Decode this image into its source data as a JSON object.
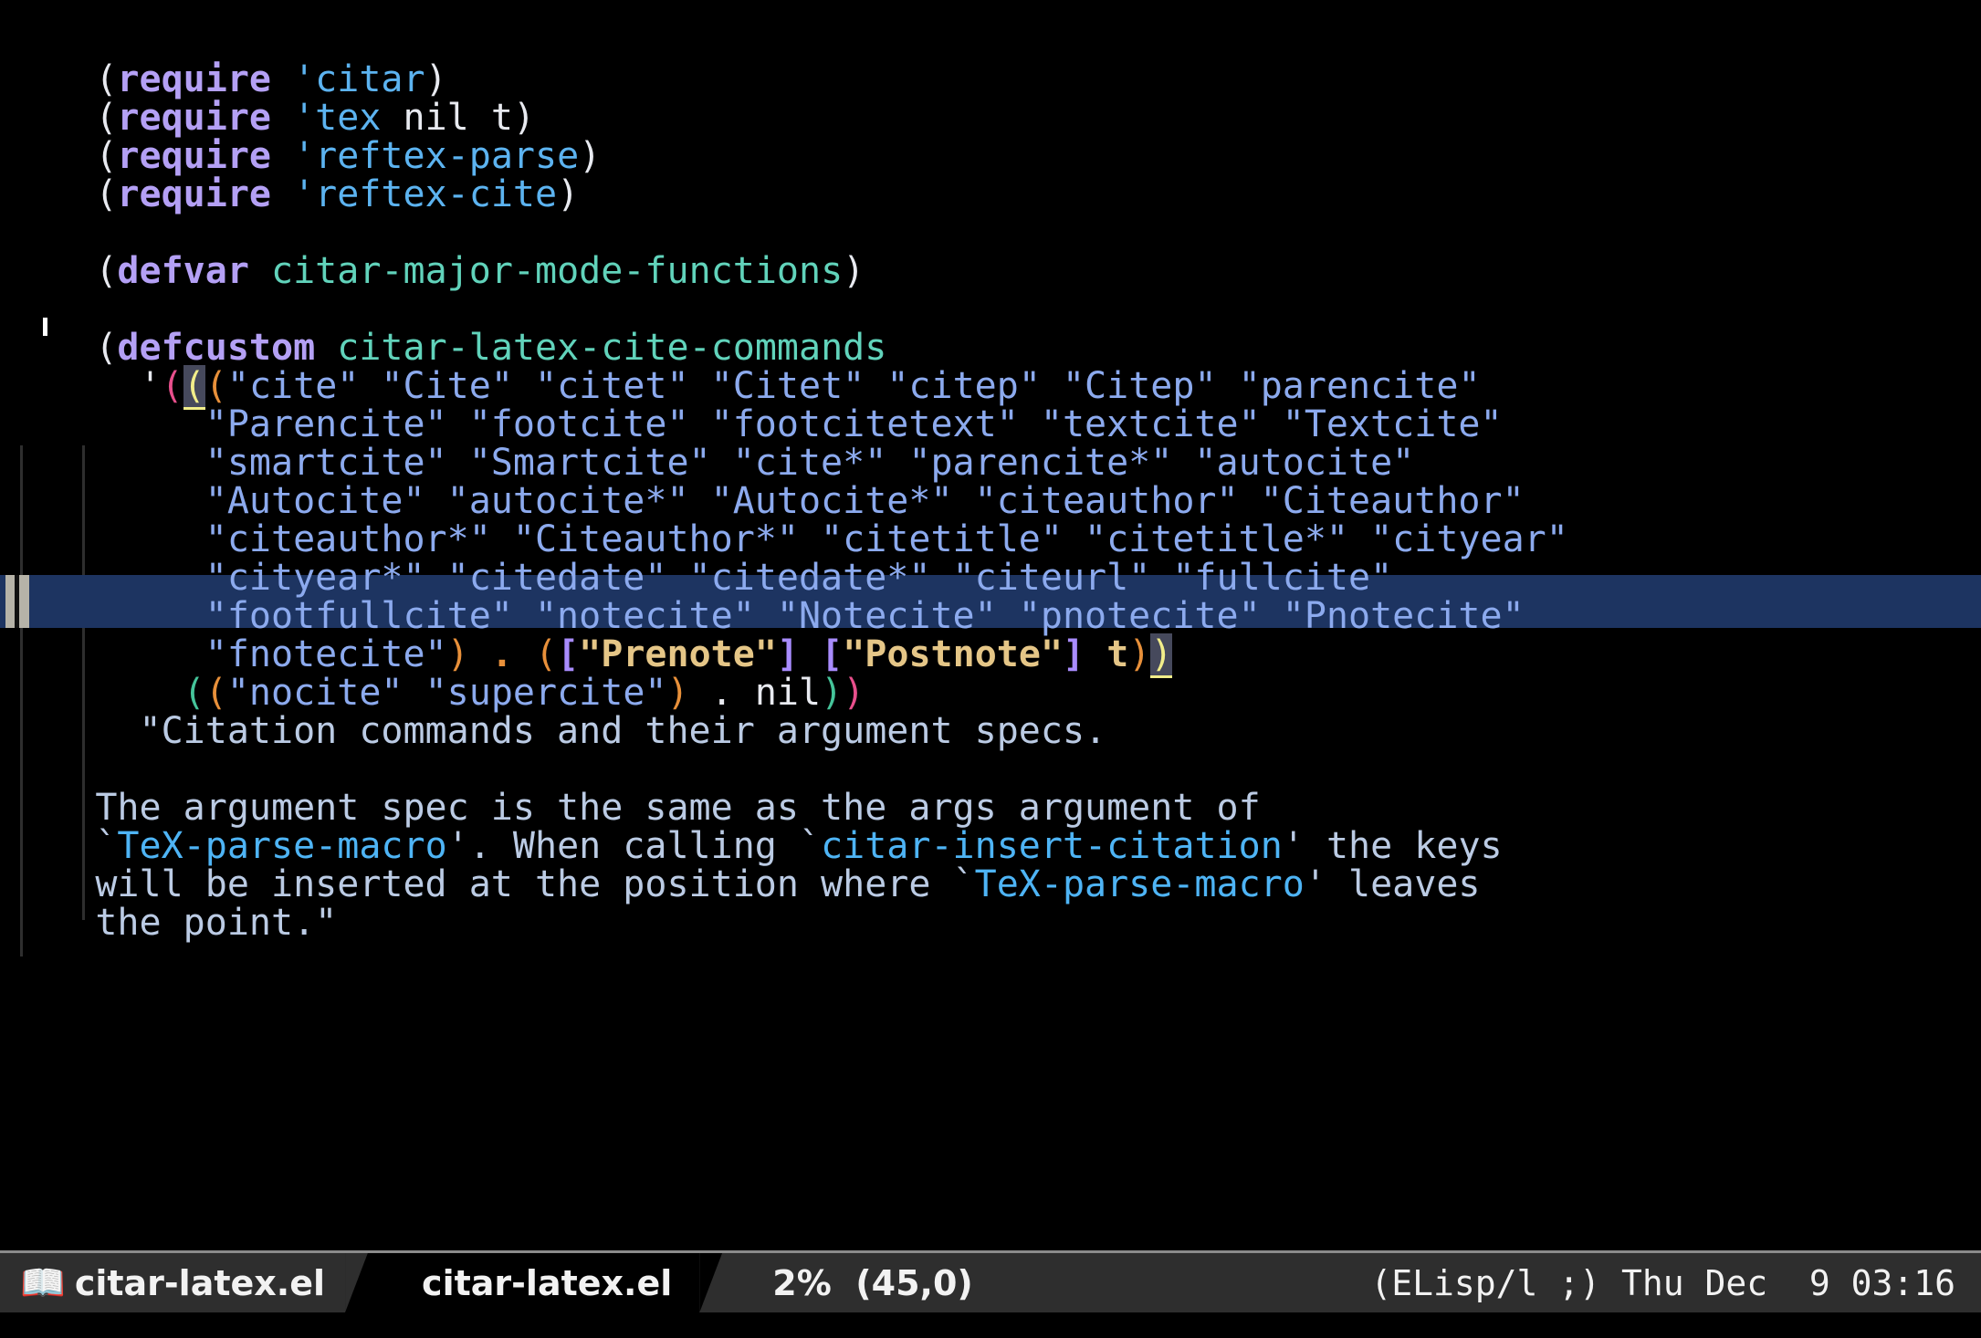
{
  "window": {
    "background": "#000000",
    "font": "monospace",
    "app": "emacs"
  },
  "colors": {
    "keyword": "#b4a0f5",
    "variable_name": "#61d3bb",
    "symbol": "#5cb3f0",
    "string": "#8caaee",
    "docstring": "#bbcbe4",
    "doc_link": "#4eb4f5",
    "delim_pink": "#e84f8c",
    "delim_yellow": "#f2ee8a",
    "delim_orange": "#e8903a",
    "delim_green": "#45c49a",
    "delim_purple": "#a98cff",
    "selection_bg": "#1d3461",
    "selected_string": "#e5c687",
    "paren_match_bg": "#46495c",
    "modeline_bg": "#2e2e2e",
    "modeline_alt_bg": "#000000"
  },
  "buffer": {
    "lines": [
      {
        "n": 1,
        "text": "(require 'citar)"
      },
      {
        "n": 2,
        "text": "(require 'tex nil t)"
      },
      {
        "n": 3,
        "text": "(require 'reftex-parse)"
      },
      {
        "n": 4,
        "text": "(require 'reftex-cite)"
      },
      {
        "n": 5,
        "text": ""
      },
      {
        "n": 6,
        "text": "(defvar citar-major-mode-functions)"
      },
      {
        "n": 7,
        "text": ""
      },
      {
        "n": 8,
        "text": "(defcustom citar-latex-cite-commands"
      },
      {
        "n": 9,
        "text": "  '(((\"cite\" \"Cite\" \"citet\" \"Citet\" \"citep\" \"Citep\" \"parencite\""
      },
      {
        "n": 10,
        "text": "     \"Parencite\" \"footcite\" \"footcitetext\" \"textcite\" \"Textcite\""
      },
      {
        "n": 11,
        "text": "     \"smartcite\" \"Smartcite\" \"cite*\" \"parencite*\" \"autocite\""
      },
      {
        "n": 12,
        "text": "     \"Autocite\" \"autocite*\" \"Autocite*\" \"citeauthor\" \"Citeauthor\""
      },
      {
        "n": 13,
        "text": "     \"citeauthor*\" \"Citeauthor*\" \"citetitle\" \"citetitle*\" \"cityear\""
      },
      {
        "n": 14,
        "text": "     \"cityear*\" \"citedate\" \"citedate*\" \"citeurl\" \"fullcite\""
      },
      {
        "n": 15,
        "text": "     \"footfullcite\" \"notecite\" \"Notecite\" \"pnotecite\" \"Pnotecite\""
      },
      {
        "n": 16,
        "text": "     \"fnotecite\") . ([\"Prenote\"] [\"Postnote\"] t))",
        "highlighted": true
      },
      {
        "n": 17,
        "text": "    ((\"nocite\" \"supercite\") . nil))"
      },
      {
        "n": 18,
        "text": "  \"Citation commands and their argument specs."
      },
      {
        "n": 19,
        "text": ""
      },
      {
        "n": 20,
        "text": "The argument spec is the same as the args argument of"
      },
      {
        "n": 21,
        "text": "`TeX-parse-macro'. When calling `citar-insert-citation' the keys"
      },
      {
        "n": 22,
        "text": "will be inserted at the position where `TeX-parse-macro' leaves"
      },
      {
        "n": 23,
        "text": "the point.\""
      }
    ],
    "tokens": {
      "require": "require",
      "defvar": "defvar",
      "defcustom": "defcustom",
      "sym_citar": "'citar",
      "sym_tex": "'tex",
      "sym_reftex_parse": "'reftex-parse",
      "sym_reftex_cite": "'reftex-cite",
      "nil": "nil",
      "t": "t",
      "var_major_mode": "citar-major-mode-functions",
      "var_cite_commands": "citar-latex-cite-commands",
      "prenote": "\"Prenote\"",
      "postnote": "\"Postnote\"",
      "doc_tex_parse_macro": "TeX-parse-macro",
      "doc_citar_insert_citation": "citar-insert-citation"
    }
  },
  "modeline": {
    "book_icon": "📖",
    "buffer_name": "citar-latex.el",
    "buffer_name_alt": "citar-latex.el",
    "percent": "2%",
    "position": "(45,0)",
    "major_mode": "(ELisp/l ;)",
    "clock": "Thu Dec  9 03:16"
  }
}
